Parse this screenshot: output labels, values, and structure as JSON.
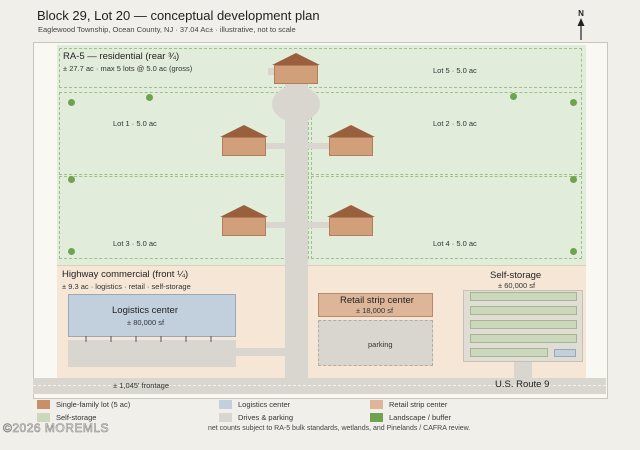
{
  "header": {
    "title": "Block 29, Lot 20 — conceptual development plan",
    "subtitle": "Eaglewood Township, Ocean County, NJ · 37.04 Ac± · illustrative, not to scale",
    "north_label": "N"
  },
  "residential": {
    "zone_title": "RA-5 — residential (rear ¾)",
    "zone_detail": "± 27.7 ac · max 5 lots @ 5.0 ac (gross)",
    "lots": [
      "Lot 1 · 5.0 ac",
      "Lot 2 · 5.0 ac",
      "Lot 3 · 5.0 ac",
      "Lot 4 · 5.0 ac",
      "Lot 5 · 5.0 ac"
    ]
  },
  "commercial": {
    "zone_title": "Highway commercial (front ¼)",
    "zone_detail": "± 9.3 ac · logistics · retail · self-storage",
    "logistics": {
      "name": "Logistics center",
      "size": "± 80,000 sf"
    },
    "retail": {
      "name": "Retail strip center",
      "size": "± 18,000 sf",
      "parking": "parking"
    },
    "storage": {
      "name": "Self-storage",
      "size": "± 60,000 sf"
    }
  },
  "road": {
    "frontage": "± 1,045' frontage",
    "name": "U.S. Route 9"
  },
  "legend": [
    {
      "label": "Single-family lot (5 ac)",
      "color": "#c98f66"
    },
    {
      "label": "Logistics center",
      "color": "#c2cfdd"
    },
    {
      "label": "Retail strip center",
      "color": "#ddb69a"
    },
    {
      "label": "Self-storage",
      "color": "#ccd8bb"
    },
    {
      "label": "Drives & parking",
      "color": "#d9d6cf"
    },
    {
      "label": "Landscape / buffer",
      "color": "#6ea34f"
    }
  ],
  "footer": {
    "note": "net counts subject to RA-5 bulk standards, wetlands, and Pinelands / CAFRA review.",
    "watermark": "©2026 MOREMLS"
  }
}
